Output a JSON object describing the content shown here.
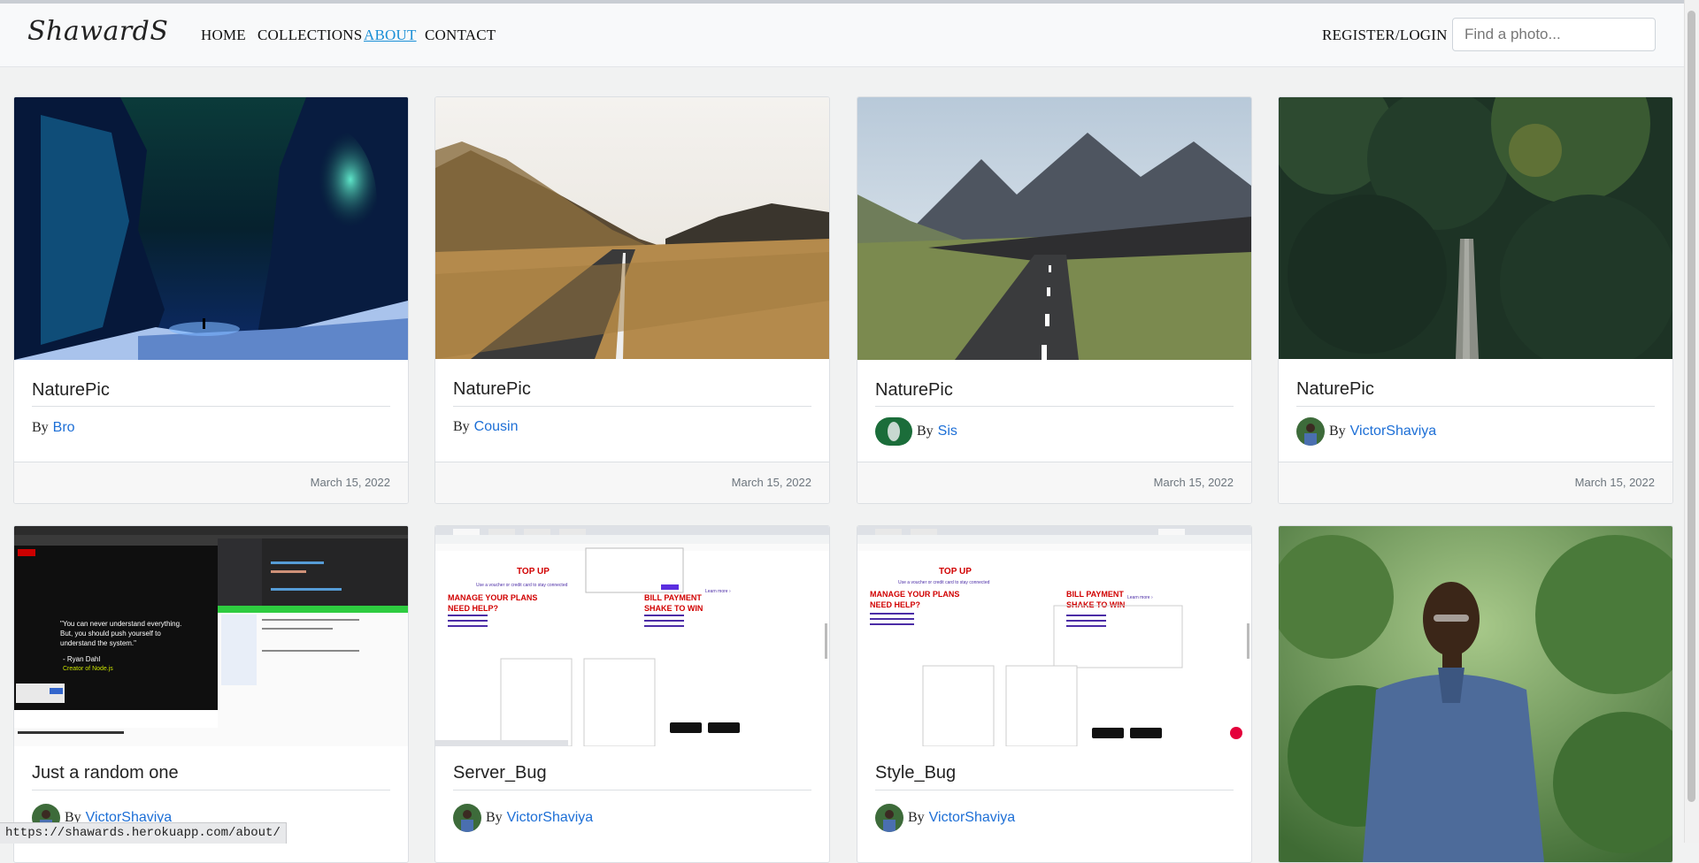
{
  "nav": {
    "brand": "ShawardS",
    "links": [
      "HOME",
      "COLLECTIONS",
      "ABOUT",
      "CONTACT"
    ],
    "active_link": "ABOUT",
    "register_login": "REGISTER/LOGIN",
    "search_placeholder": "Find a photo..."
  },
  "cards": [
    {
      "title": "NaturePic",
      "by": "By",
      "author": "Bro",
      "date": "March 15, 2022",
      "image": "aurora-cave-photo"
    },
    {
      "title": "NaturePic",
      "by": "By",
      "author": "Cousin",
      "date": "March 15, 2022",
      "image": "desert-road-photo"
    },
    {
      "title": "NaturePic",
      "by": "By",
      "author": "Sis",
      "date": "March 15, 2022",
      "image": "mountain-road-photo"
    },
    {
      "title": "NaturePic",
      "by": "By",
      "author": "VictorShaviya",
      "date": "March 15, 2022",
      "image": "forest-bridge-photo"
    },
    {
      "title": "Just a random one",
      "by": "By",
      "author": "VictorShaviya",
      "image": "code-screenshot-photo"
    },
    {
      "title": "Server_Bug",
      "by": "By",
      "author": "VictorShaviya",
      "image": "webpage-bug-screenshot"
    },
    {
      "title": "Style_Bug",
      "by": "By",
      "author": "VictorShaviya",
      "image": "webpage-style-screenshot"
    },
    {
      "title": "",
      "image": "portrait-photo"
    }
  ],
  "screenshot_text": {
    "quote": "\"You can never understand everything. But, you should push yourself to understand the system.\"",
    "quote_author": "- Ryan Dahl",
    "quote_role": "Creator of Node.js",
    "top_up": "TOP UP",
    "top_up_sub": "Use a voucher or credit card to stay connected",
    "manage": "MANAGE YOUR PLANS",
    "help": "NEED HELP?",
    "bill": "BILL PAYMENT",
    "shake": "SHAKE TO WIN",
    "learn": "Learn more ›"
  },
  "status_bar": {
    "url": "https://shawards.herokuapp.com/about/"
  },
  "colors": {
    "link": "#1d6fd6",
    "active_nav": "#1a8fd6",
    "page_bg": "#f1f2f2"
  }
}
